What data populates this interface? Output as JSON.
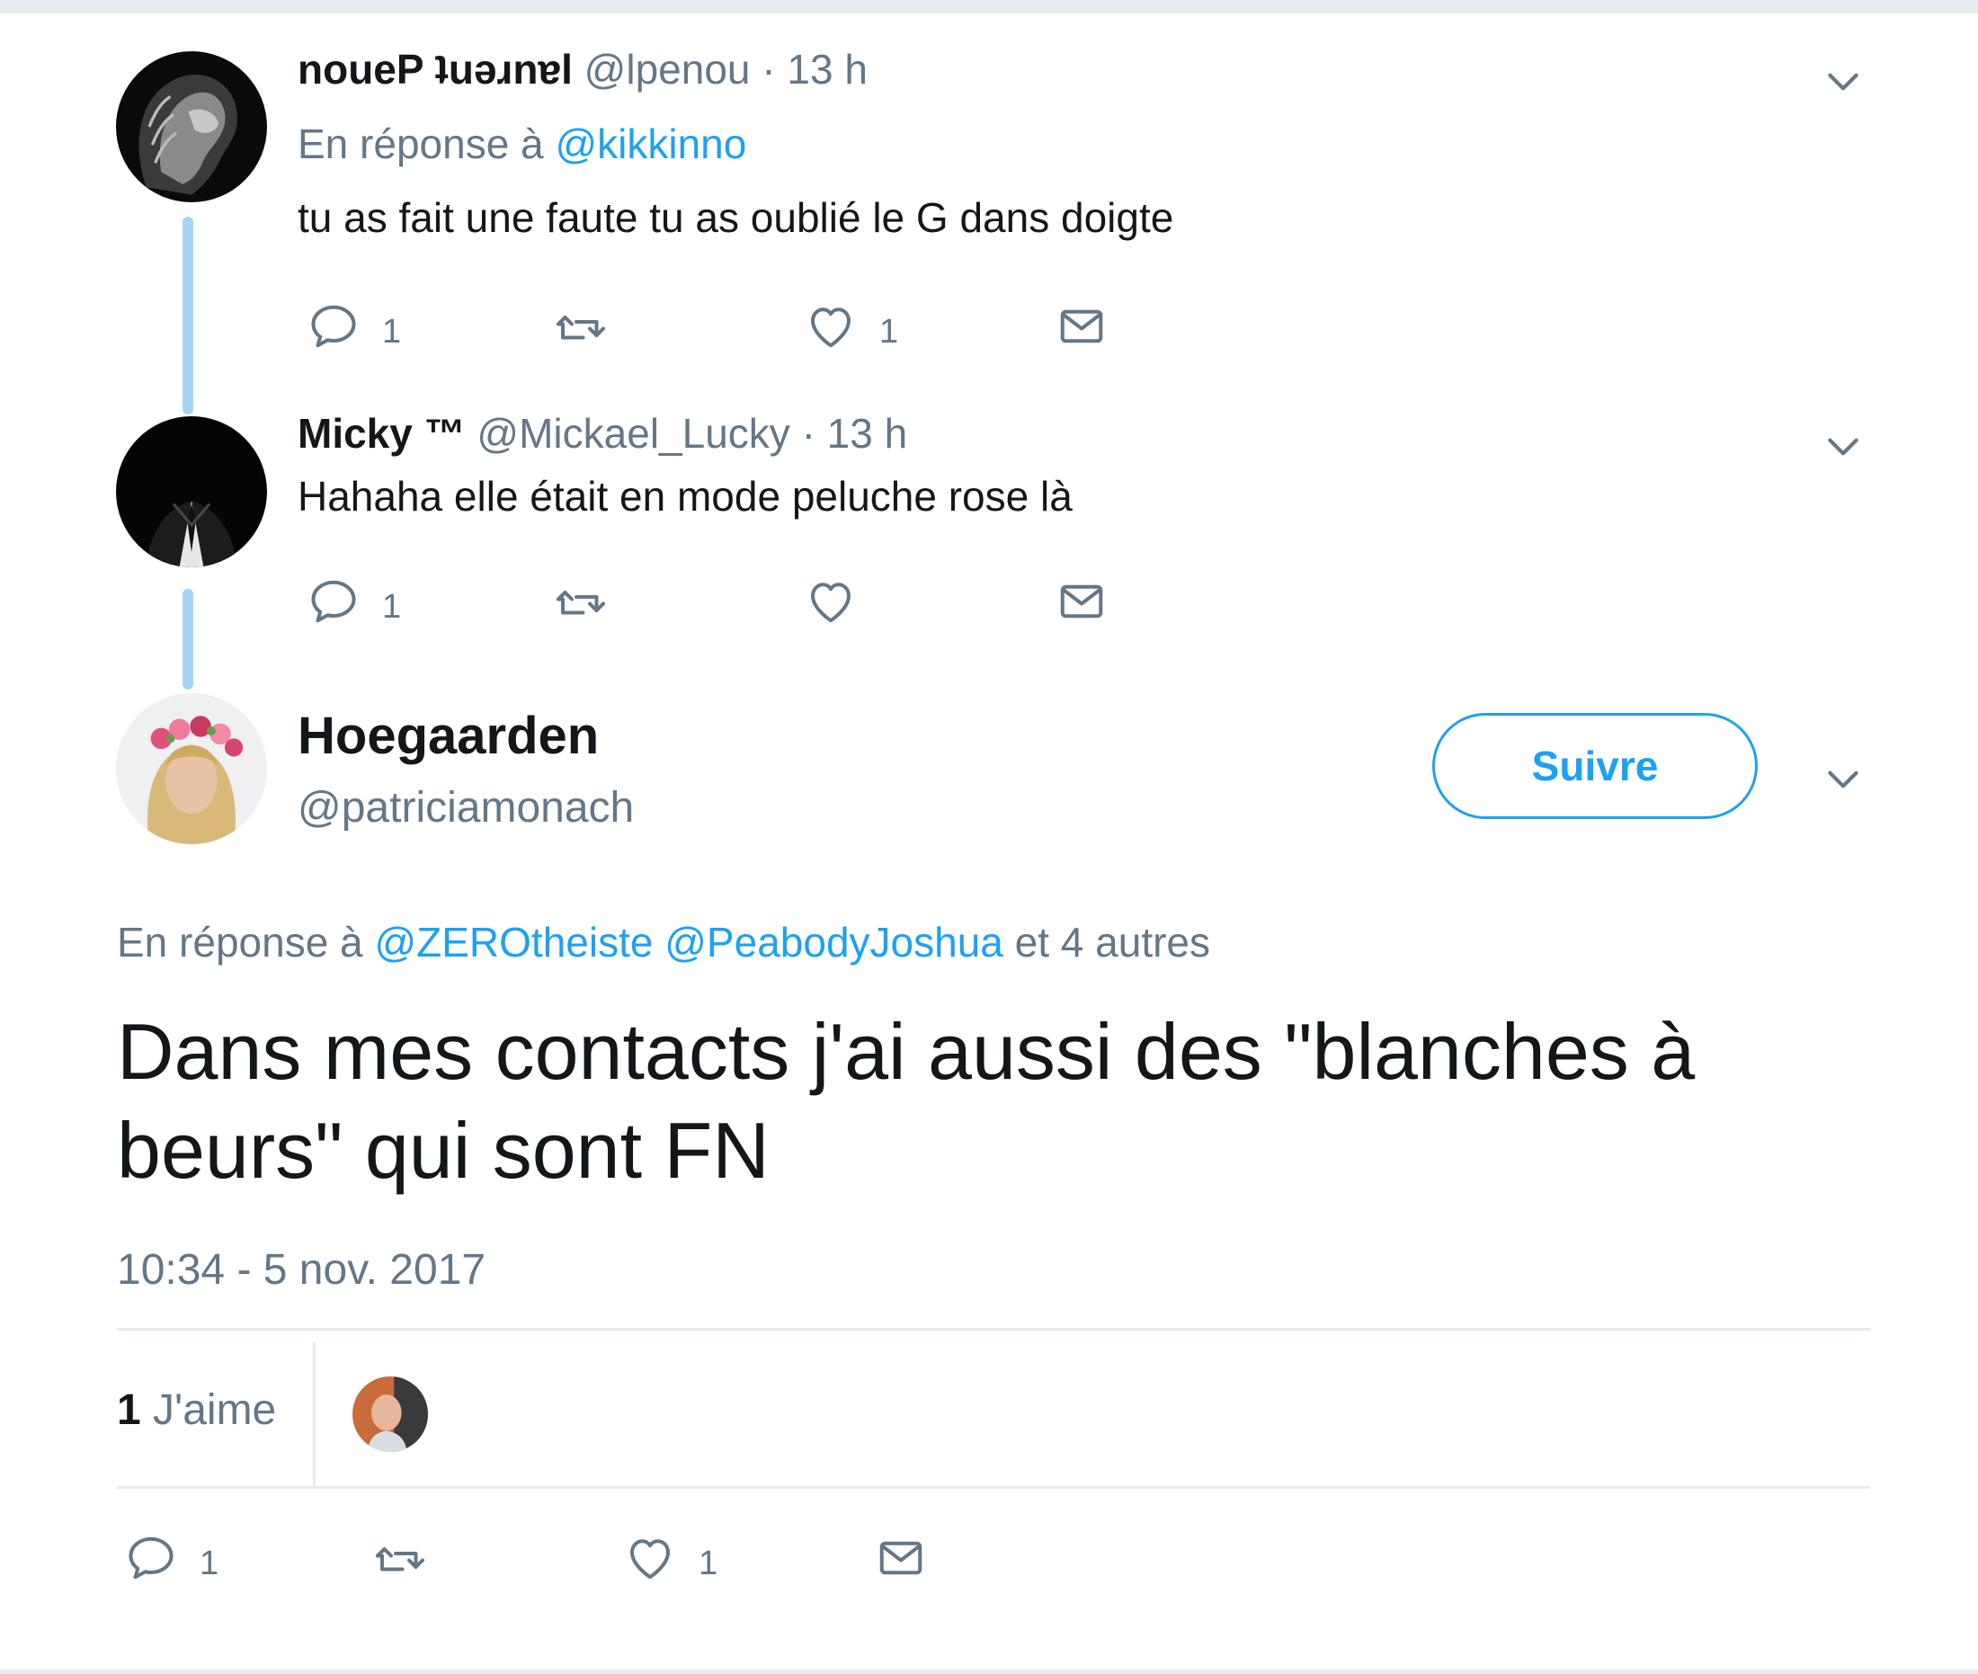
{
  "tweets": [
    {
      "name": "Laurent Penou",
      "name_display": "noueP ʇuǝɹnɐl",
      "handle": "@lpenou",
      "time": "· 13 h",
      "reply_prefix": "En réponse à",
      "reply_to": "@kikkinno",
      "text": "tu as fait une faute tu as oublié le G dans doigte",
      "replies": "1",
      "retweets": "",
      "likes": "1"
    },
    {
      "name": "Micky ™",
      "handle": "@Mickael_Lucky",
      "time": "· 13 h",
      "text": "Hahaha elle était en mode peluche rose là",
      "replies": "1",
      "retweets": "",
      "likes": ""
    }
  ],
  "main_tweet": {
    "name": "Hoegaarden",
    "handle": "@patriciamonach",
    "follow_label": "Suivre",
    "reply_prefix": "En réponse à",
    "reply_to_1": "@ZEROtheiste",
    "reply_to_2": "@PeabodyJoshua",
    "reply_suffix": "et 4 autres",
    "text": "Dans mes contacts j'ai aussi des \"blanches à beurs\" qui sont FN",
    "timestamp": "10:34 - 5 nov. 2017",
    "likes_count": "1",
    "likes_label": "J'aime",
    "replies": "1",
    "retweets": "",
    "likes": "1"
  },
  "icons": {
    "reply": "reply-icon",
    "retweet": "retweet-icon",
    "like": "heart-icon",
    "dm": "envelope-icon",
    "more": "chevron-down-icon"
  },
  "colors": {
    "accent": "#1da1f2",
    "muted": "#657786",
    "thread_line": "#a6d5f8",
    "text": "#14171a"
  }
}
